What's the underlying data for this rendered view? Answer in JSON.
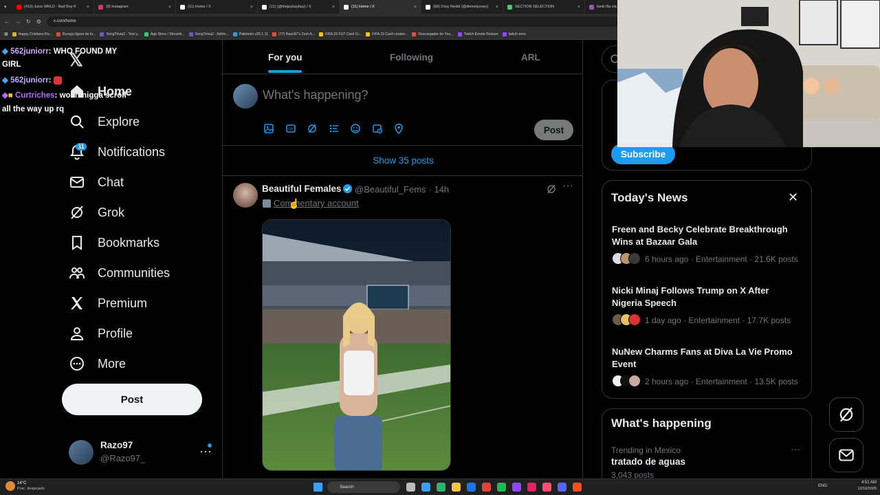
{
  "browser": {
    "tabs": [
      {
        "title": "(410) Juice WRLD - Bad Boy ft",
        "color": "#ff0000"
      },
      {
        "title": "(8) Instagram",
        "color": "#e1306c"
      },
      {
        "title": "(11) Home / X",
        "color": "#ffffff"
      },
      {
        "title": "(11) (@thejaybaybay) / X",
        "color": "#ffffff"
      },
      {
        "title": "(11) Home / X",
        "color": "#ffffff",
        "active": true
      },
      {
        "title": "(69) Zoey Reddi (@divinelyzoey)",
        "color": "#ffffff"
      },
      {
        "title": "SECTION SELECTION",
        "color": "#4ecb71"
      },
      {
        "title": "fanki fila via",
        "color": "#9b59b6"
      }
    ],
    "url": "x.com/home",
    "bookmarks": [
      {
        "label": "Happy Cristiano Ro...",
        "color": "#e0b030"
      },
      {
        "label": "Burago figura de to...",
        "color": "#d0503c"
      },
      {
        "label": "SongTrivia2 - Test y...",
        "color": "#6a5acd"
      },
      {
        "label": "App Store / Streami...",
        "color": "#2ecc71"
      },
      {
        "label": "SongTrivia2 - Advin...",
        "color": "#6a5acd"
      },
      {
        "label": "Paletools v25.1.11",
        "color": "#3498db"
      },
      {
        "label": "(77) Razo97's Zest-A...",
        "color": "#e74c3c"
      },
      {
        "label": "FIFA 23 FUT Card Cr...",
        "color": "#f1c40f"
      },
      {
        "label": "FIFA 23 Card creator...",
        "color": "#f1c40f"
      },
      {
        "label": "Descargador de You...",
        "color": "#e74c3c"
      },
      {
        "label": "Twitch Emote Resizer",
        "color": "#9146ff"
      },
      {
        "label": "twitch emo",
        "color": "#9146ff"
      }
    ]
  },
  "chat": [
    {
      "user": "562juniorr",
      "msg": ": WHO FOUND MY",
      "color": "#c7a8ff"
    },
    {
      "user": "",
      "msg": "GIRL",
      "color": "#fff"
    },
    {
      "user": "562juniorr",
      "msg": ":",
      "color": "#c7a8ff"
    },
    {
      "user": "Curtriches",
      "msg": ": woah nigga scroll",
      "color": "#b36bff"
    },
    {
      "user": "",
      "msg": "all the way up rq",
      "color": "#fff"
    }
  ],
  "nav": {
    "items": [
      {
        "label": "Home"
      },
      {
        "label": "Explore"
      },
      {
        "label": "Notifications",
        "badge": "11"
      },
      {
        "label": "Chat"
      },
      {
        "label": "Grok"
      },
      {
        "label": "Bookmarks"
      },
      {
        "label": "Communities"
      },
      {
        "label": "Premium"
      },
      {
        "label": "Profile"
      },
      {
        "label": "More"
      }
    ],
    "post_label": "Post",
    "account": {
      "name": "Razo97",
      "handle": "@Razo97_"
    }
  },
  "feed": {
    "tabs": [
      "For you",
      "Following",
      "ARL"
    ],
    "composer_placeholder": "What's happening?",
    "composer_post": "Post",
    "show_posts": "Show 35 posts",
    "post": {
      "name": "Beautiful Females",
      "handle": "@Beautiful_Fems",
      "time": "· 14h",
      "label": "Commentary account"
    }
  },
  "right": {
    "subscribe": "Subscribe",
    "news_title": "Today's News",
    "news": [
      {
        "title": "Freen and Becky Celebrate Breakthrough Wins at Bazaar Gala",
        "meta": "6 hours ago · Entertainment · 21.6K posts"
      },
      {
        "title": "Nicki Minaj Follows Trump on X After Nigeria Speech",
        "meta": "1 day ago · Entertainment · 17.7K posts"
      },
      {
        "title": "NuNew Charms Fans at Diva La Vie Promo Event",
        "meta": "2 hours ago · Entertainment · 13.5K posts"
      }
    ],
    "happening_title": "What's happening",
    "trend": {
      "context": "Trending in Mexico",
      "title": "tratado de aguas",
      "posts": "3,043 posts"
    }
  },
  "taskbar": {
    "weather_temp": "14°C",
    "weather_desc": "Prac. despejado",
    "search": "Search",
    "lang": "ENG",
    "time": "4:51 AM",
    "date": "12/10/2025"
  },
  "colors": {
    "accent": "#1d9bf0",
    "bg": "#000000",
    "border": "#2f3336",
    "muted": "#71767b"
  }
}
